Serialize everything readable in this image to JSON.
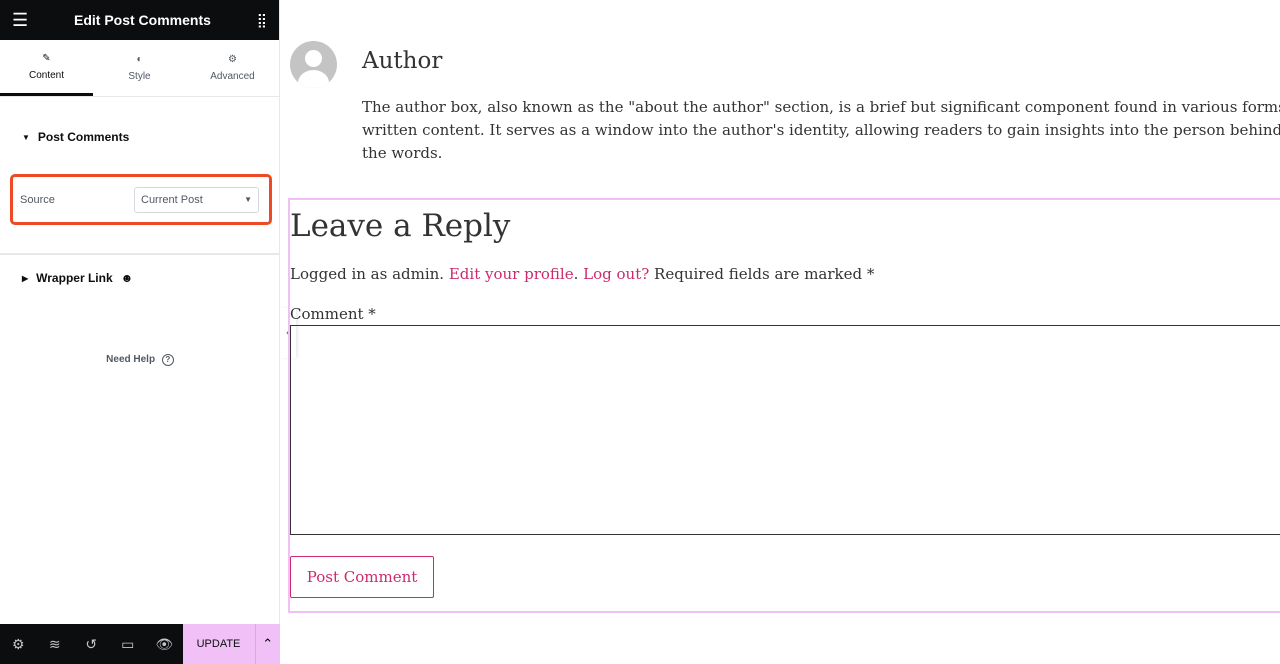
{
  "panel": {
    "title": "Edit Post Comments",
    "tabs": [
      {
        "label": "Content"
      },
      {
        "label": "Style"
      },
      {
        "label": "Advanced"
      }
    ],
    "section1": "Post Comments",
    "source_label": "Source",
    "source_value": "Current Post",
    "section2": "Wrapper Link",
    "help": "Need Help",
    "update": "UPDATE"
  },
  "main": {
    "author_name": "Author",
    "author_bio": [
      "The author box, also known as the \"about the author\" section, is a brief but significant component found in various forms of",
      "written content. It serves as a window into the author's identity, allowing readers to gain insights into the person behind",
      "the words."
    ],
    "reply_title": "Leave a Reply",
    "logged_in": "Logged in as admin.",
    "edit_profile": "Edit your profile",
    "log_out": "Log out?",
    "required": "Required fields are marked *",
    "comment_label": "Comment *",
    "post_button": "Post Comment"
  },
  "colors": {
    "accent": "#cc2a6e",
    "highlight": "#f04a24",
    "update_bg": "#f1c0f7"
  }
}
